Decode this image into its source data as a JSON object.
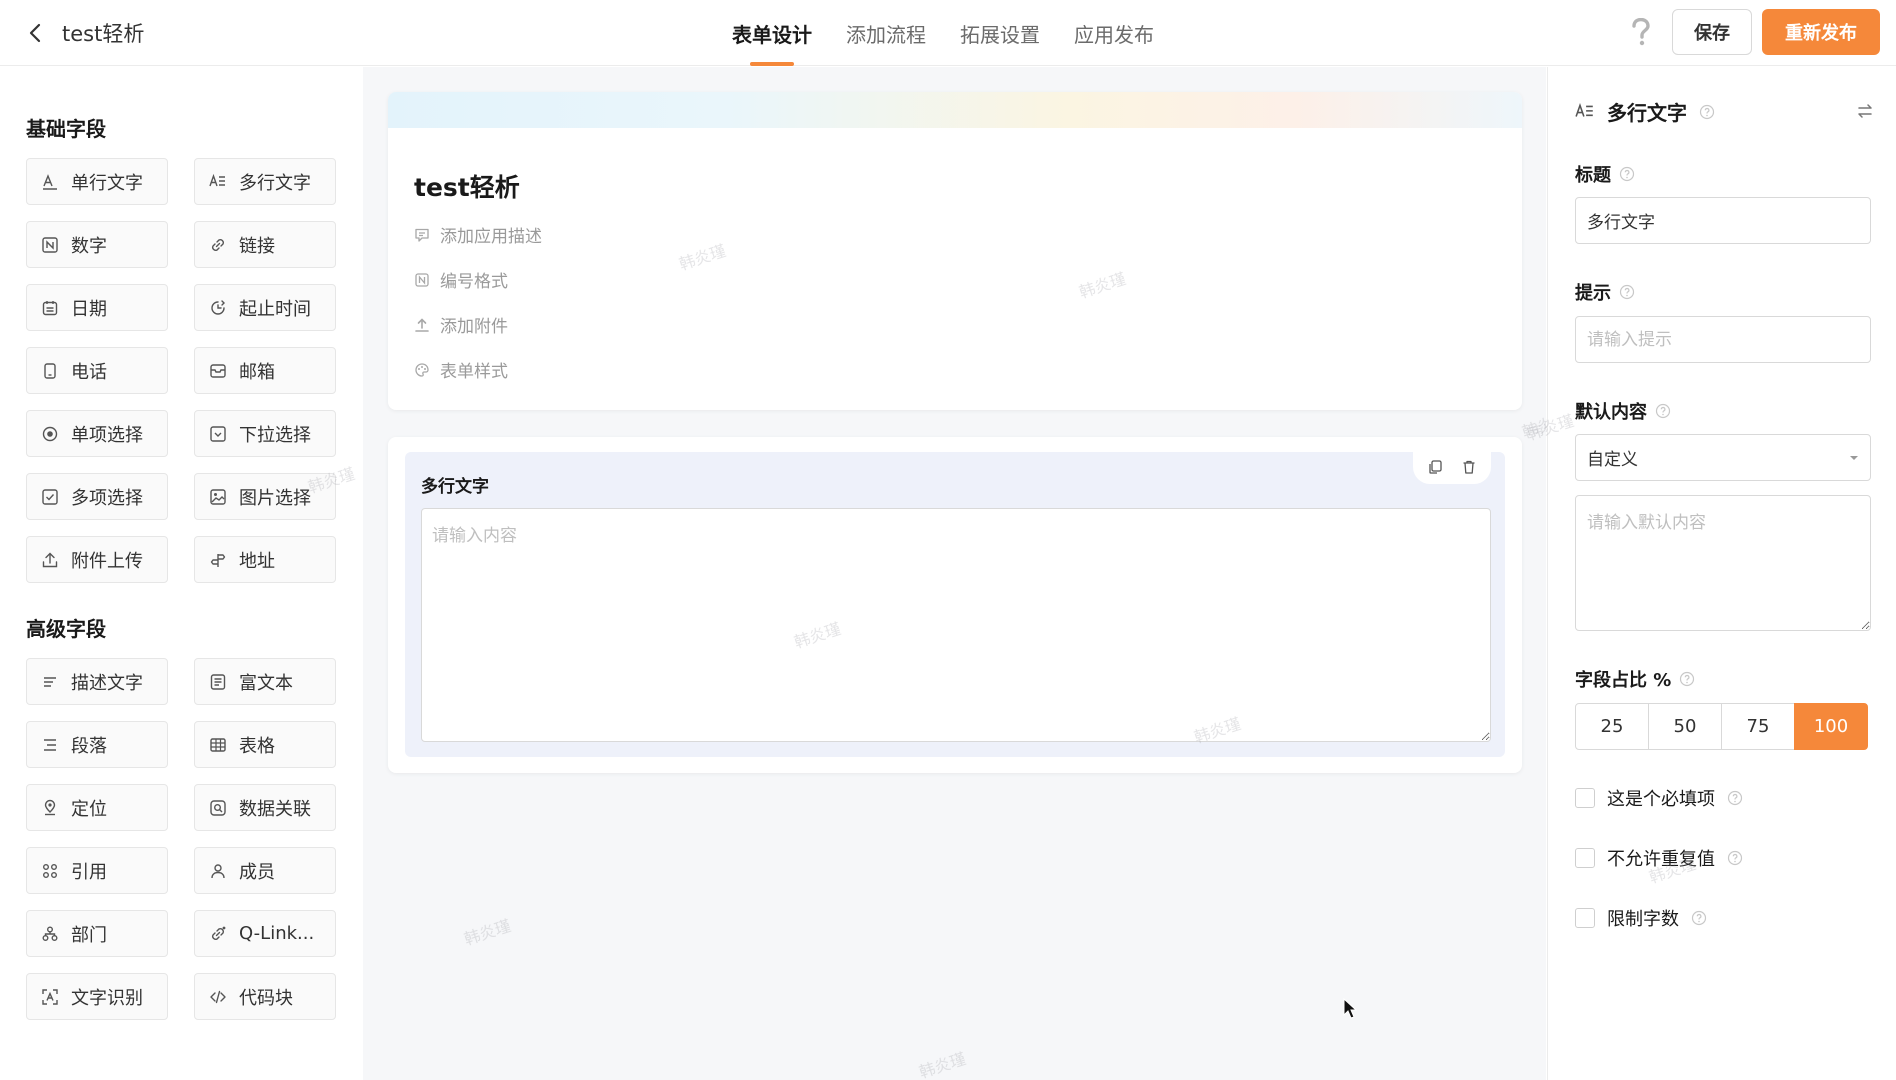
{
  "header": {
    "app_title": "test轻析",
    "tabs": [
      {
        "label": "表单设计",
        "active": true
      },
      {
        "label": "添加流程",
        "active": false
      },
      {
        "label": "拓展设置",
        "active": false
      },
      {
        "label": "应用发布",
        "active": false
      }
    ],
    "save_label": "保存",
    "publish_label": "重新发布"
  },
  "left_panel": {
    "basic_title": "基础字段",
    "basic_fields": [
      {
        "label": "单行文字",
        "icon": "single-line-text-icon"
      },
      {
        "label": "多行文字",
        "icon": "multi-line-text-icon"
      },
      {
        "label": "数字",
        "icon": "number-icon"
      },
      {
        "label": "链接",
        "icon": "link-icon"
      },
      {
        "label": "日期",
        "icon": "calendar-icon"
      },
      {
        "label": "起止时间",
        "icon": "time-range-icon"
      },
      {
        "label": "电话",
        "icon": "phone-icon"
      },
      {
        "label": "邮箱",
        "icon": "mail-icon"
      },
      {
        "label": "单项选择",
        "icon": "radio-icon"
      },
      {
        "label": "下拉选择",
        "icon": "dropdown-icon"
      },
      {
        "label": "多项选择",
        "icon": "checkbox-icon"
      },
      {
        "label": "图片选择",
        "icon": "image-icon"
      },
      {
        "label": "附件上传",
        "icon": "upload-icon"
      },
      {
        "label": "地址",
        "icon": "address-icon"
      }
    ],
    "advanced_title": "高级字段",
    "advanced_fields": [
      {
        "label": "描述文字",
        "icon": "description-icon"
      },
      {
        "label": "富文本",
        "icon": "rich-text-icon"
      },
      {
        "label": "段落",
        "icon": "paragraph-icon"
      },
      {
        "label": "表格",
        "icon": "table-icon"
      },
      {
        "label": "定位",
        "icon": "location-icon"
      },
      {
        "label": "数据关联",
        "icon": "data-link-icon"
      },
      {
        "label": "引用",
        "icon": "reference-icon"
      },
      {
        "label": "成员",
        "icon": "member-icon"
      },
      {
        "label": "部门",
        "icon": "department-icon"
      },
      {
        "label": "Q-Link...",
        "icon": "qlink-icon"
      },
      {
        "label": "文字识别",
        "icon": "ocr-icon"
      },
      {
        "label": "代码块",
        "icon": "code-icon"
      }
    ]
  },
  "canvas": {
    "form_title": "test轻析",
    "info_rows": [
      {
        "label": "添加应用描述",
        "icon": "comment-icon"
      },
      {
        "label": "编号格式",
        "icon": "number-format-icon"
      },
      {
        "label": "添加附件",
        "icon": "attachment-upload-icon"
      },
      {
        "label": "表单样式",
        "icon": "palette-icon"
      }
    ],
    "field_label": "多行文字",
    "field_placeholder": "请输入内容",
    "watermark_text": "韩炎瑾"
  },
  "right_panel": {
    "header_title": "多行文字",
    "title_label": "标题",
    "title_value": "多行文字",
    "hint_label": "提示",
    "hint_placeholder": "请输入提示",
    "default_label": "默认内容",
    "default_select": "自定义",
    "default_placeholder": "请输入默认内容",
    "ratio_label": "字段占比 %",
    "ratio_options": [
      "25",
      "50",
      "75",
      "100"
    ],
    "ratio_selected": "100",
    "checks": [
      {
        "label": "这是个必填项",
        "checked": false
      },
      {
        "label": "不允许重复值",
        "checked": false
      },
      {
        "label": "限制字数",
        "checked": false
      }
    ]
  },
  "colors": {
    "accent": "#f5883a",
    "field_block_bg": "#eef1fa",
    "canvas_bg": "#f6f7f9"
  }
}
